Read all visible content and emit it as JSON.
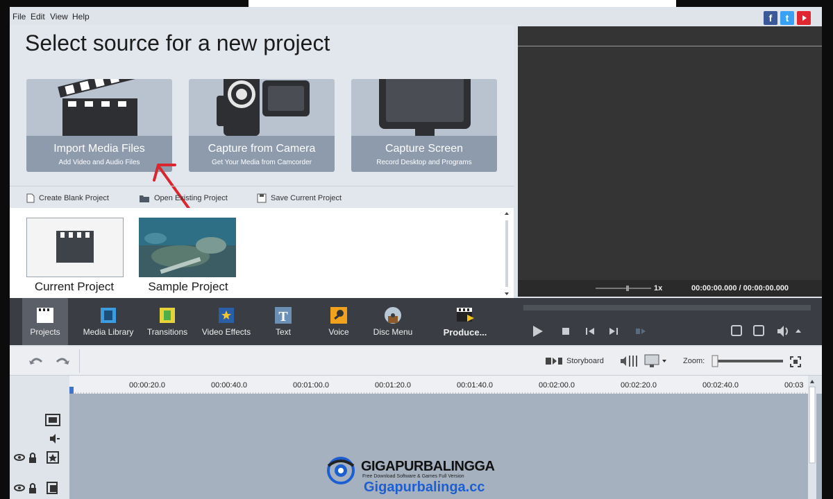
{
  "menu": {
    "file": "File",
    "edit": "Edit",
    "view": "View",
    "help": "Help"
  },
  "social": {
    "facebook": "f",
    "twitter": "t"
  },
  "source": {
    "title": "Select source for a new project",
    "tiles": [
      {
        "label": "Import Media Files",
        "sub": "Add Video and Audio Files"
      },
      {
        "label": "Capture from Camera",
        "sub": "Get Your Media from Camcorder"
      },
      {
        "label": "Capture Screen",
        "sub": "Record Desktop and Programs"
      }
    ],
    "actions": [
      "Create Blank Project",
      "Open Existing Project",
      "Save Current Project"
    ],
    "projects": [
      "Current Project",
      "Sample Project"
    ]
  },
  "preview": {
    "speed": "1x",
    "time": "00:00:00.000 / 00:00:00.000"
  },
  "tools": [
    "Projects",
    "Media Library",
    "Transitions",
    "Video Effects",
    "Text",
    "Voice",
    "Disc Menu",
    "Produce..."
  ],
  "timeline": {
    "storyboard": "Storyboard",
    "zoom_label": "Zoom:",
    "ruler": [
      "00:00:20.0",
      "00:00:40.0",
      "00:01:00.0",
      "00:01:20.0",
      "00:01:40.0",
      "00:02:00.0",
      "00:02:20.0",
      "00:02:40.0",
      "00:03"
    ]
  },
  "watermark": {
    "brand": "GIGAPURBALINGGA",
    "tagline": "Free Download Software & Games Full Version",
    "url": "Gigapurbalinga.cc"
  },
  "colors": {
    "accent": "#e0262f",
    "preview_bg": "#343434",
    "toolbar_bg": "#3a3d43",
    "tracks_bg": "#a6b1c0"
  }
}
